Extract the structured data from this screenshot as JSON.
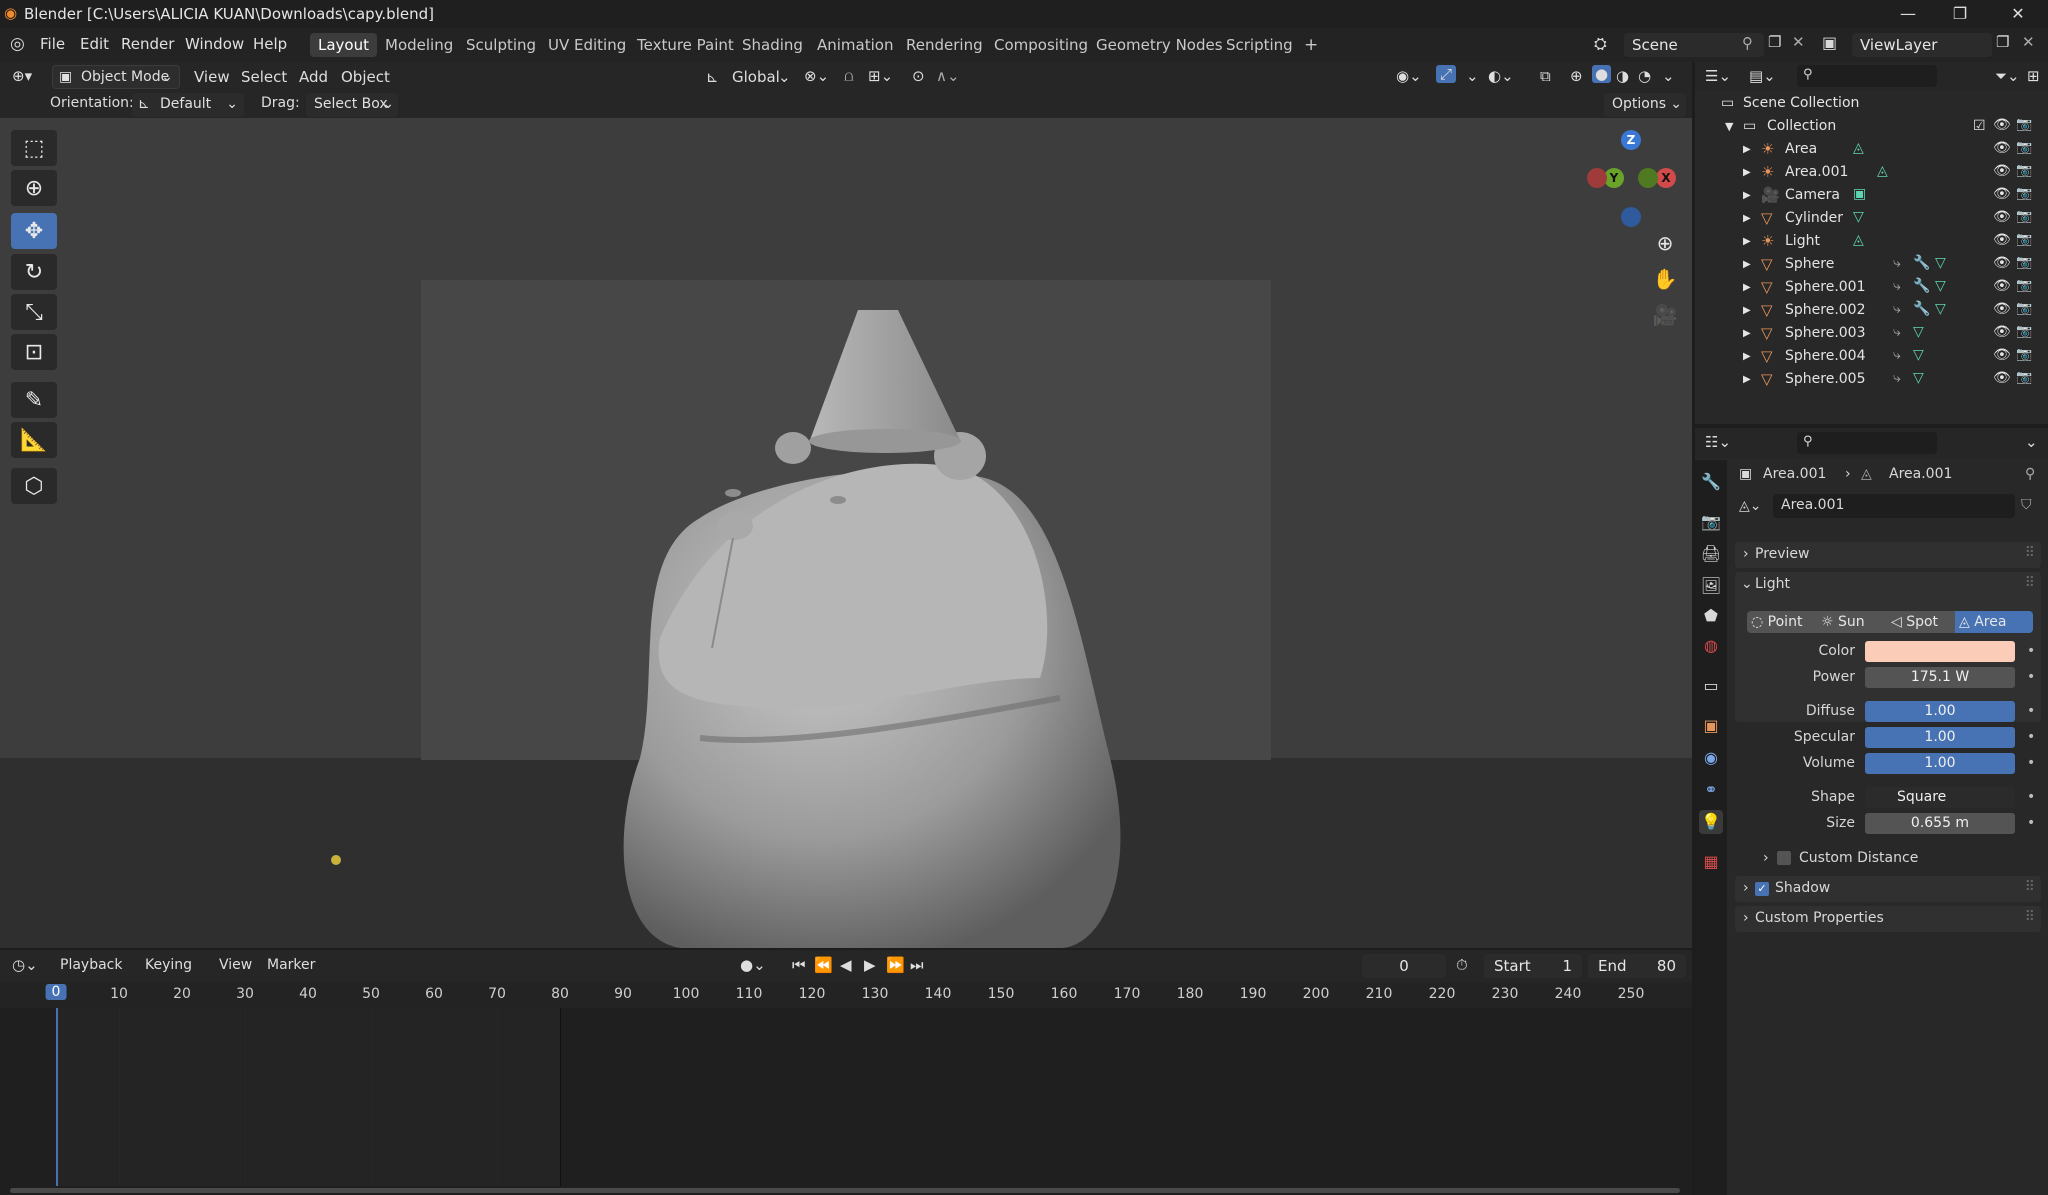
{
  "window": {
    "title": "Blender [C:\\Users\\ALICIA KUAN\\Downloads\\capy.blend]",
    "controls": [
      "—",
      "❐",
      "✕"
    ]
  },
  "menu": [
    "File",
    "Edit",
    "Render",
    "Window",
    "Help"
  ],
  "workspaces": [
    "Layout",
    "Modeling",
    "Sculpting",
    "UV Editing",
    "Texture Paint",
    "Shading",
    "Animation",
    "Rendering",
    "Compositing",
    "Geometry Nodes",
    "Scripting"
  ],
  "active_workspace": "Layout",
  "add_workspace": "+",
  "scene": {
    "name": "Scene",
    "view_layer": "ViewLayer"
  },
  "viewport_header": {
    "mode": "Object Mode",
    "menus": [
      "View",
      "Select",
      "Add",
      "Object"
    ],
    "transform_orientation": "Global",
    "orientation_label": "Orientation:",
    "orientation_value": "Default",
    "drag_label": "Drag:",
    "drag_value": "Select Box",
    "options": "Options"
  },
  "gizmo": {
    "z": "Z",
    "y": "Y",
    "x": "X"
  },
  "tools": [
    "select-box",
    "cursor",
    "move",
    "rotate",
    "scale",
    "transform",
    "annotate",
    "measure",
    "add-cube"
  ],
  "active_tool": "move",
  "timeline": {
    "menus": [
      "Playback",
      "Keying",
      "View",
      "Marker"
    ],
    "current_frame": "0",
    "start_label": "Start",
    "start": "1",
    "end_label": "End",
    "end": "80",
    "ticks": [
      "0",
      "10",
      "20",
      "30",
      "40",
      "50",
      "60",
      "70",
      "80",
      "90",
      "100",
      "110",
      "120",
      "130",
      "140",
      "150",
      "160",
      "170",
      "180",
      "190",
      "200",
      "210",
      "220",
      "230",
      "240",
      "250"
    ]
  },
  "outliner": {
    "root": "Scene Collection",
    "collection": "Collection",
    "items": [
      {
        "name": "Area",
        "type": "light"
      },
      {
        "name": "Area.001",
        "type": "light"
      },
      {
        "name": "Camera",
        "type": "camera"
      },
      {
        "name": "Cylinder",
        "type": "mesh"
      },
      {
        "name": "Light",
        "type": "light"
      },
      {
        "name": "Sphere",
        "type": "mesh"
      },
      {
        "name": "Sphere.001",
        "type": "mesh"
      },
      {
        "name": "Sphere.002",
        "type": "mesh"
      },
      {
        "name": "Sphere.003",
        "type": "mesh"
      },
      {
        "name": "Sphere.004",
        "type": "mesh"
      },
      {
        "name": "Sphere.005",
        "type": "mesh"
      }
    ]
  },
  "properties": {
    "breadcrumb_object": "Area.001",
    "breadcrumb_data": "Area.001",
    "datablock_name": "Area.001",
    "preview_label": "Preview",
    "light_label": "Light",
    "light_types": [
      "Point",
      "Sun",
      "Spot",
      "Area"
    ],
    "active_light_type": "Area",
    "color_label": "Color",
    "color_value": "#fbcdb8",
    "power_label": "Power",
    "power": "175.1 W",
    "diffuse_label": "Diffuse",
    "diffuse": "1.00",
    "specular_label": "Specular",
    "specular": "1.00",
    "volume_label": "Volume",
    "volume": "1.00",
    "shape_label": "Shape",
    "shape": "Square",
    "size_label": "Size",
    "size": "0.655 m",
    "custom_distance_label": "Custom Distance",
    "shadow_label": "Shadow",
    "custom_properties_label": "Custom Properties"
  },
  "colors": {
    "accent": "#4772b3",
    "object_orange": "#e8955a",
    "data_teal": "#5fd4b3"
  }
}
